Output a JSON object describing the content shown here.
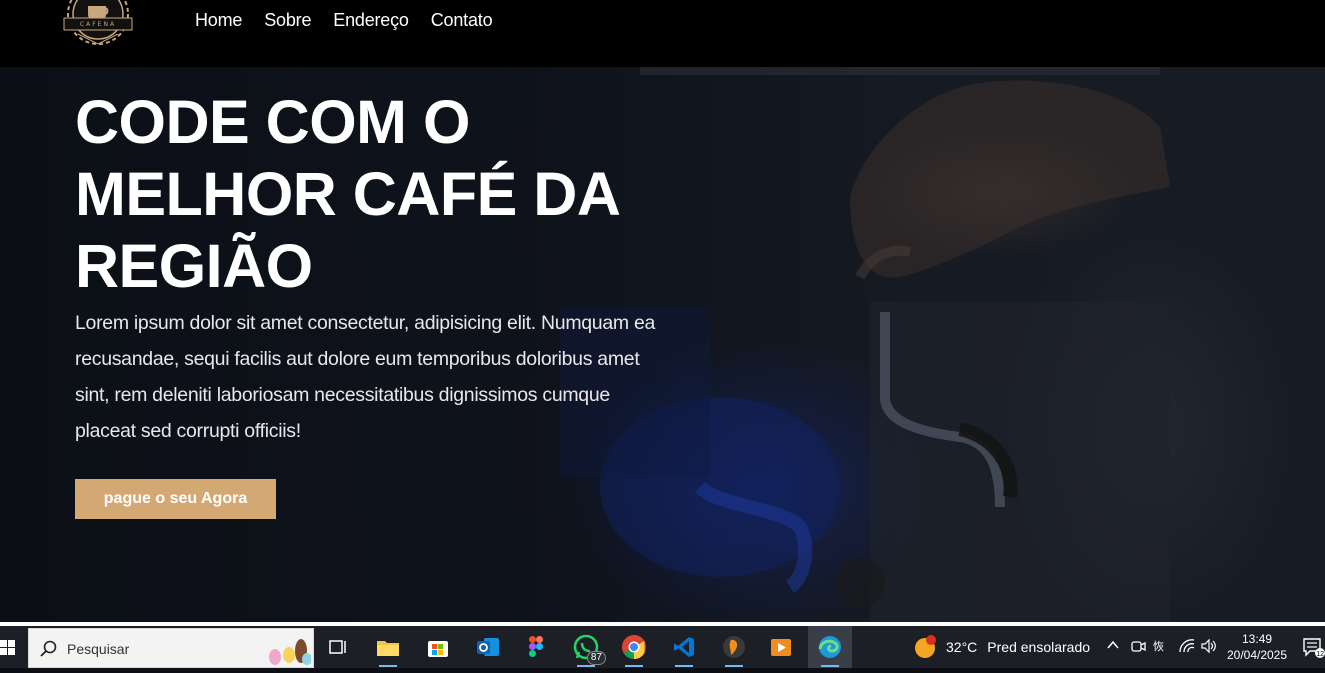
{
  "nav": {
    "logo_text": "CAFENA",
    "links": [
      "Home",
      "Sobre",
      "Endereço",
      "Contato"
    ]
  },
  "hero": {
    "title": "CODE COM O MELHOR CAFÉ DA REGIÃO",
    "text": "Lorem ipsum dolor sit amet consectetur, adipisicing elit. Numquam ea recusandae, sequi facilis aut dolore eum temporibus doloribus amet sint, rem deleniti laboriosam necessitatibus dignissimos cumque placeat sed corrupti officiis!",
    "button_label": "pague o seu Agora"
  },
  "taskbar": {
    "search_placeholder": "Pesquisar",
    "apps": [
      {
        "name": "task-view-icon"
      },
      {
        "name": "file-explorer-icon"
      },
      {
        "name": "microsoft-store-icon"
      },
      {
        "name": "outlook-icon"
      },
      {
        "name": "figma-icon"
      },
      {
        "name": "whatsapp-icon",
        "badge": "87"
      },
      {
        "name": "chrome-icon"
      },
      {
        "name": "vscode-icon"
      },
      {
        "name": "fl-studio-icon"
      },
      {
        "name": "media-player-icon"
      },
      {
        "name": "edge-icon"
      }
    ],
    "weather": {
      "badge": "1",
      "temp": "32°C",
      "desc": "Pred ensolarado"
    },
    "clock": {
      "time": "13:49",
      "date": "20/04/2025"
    },
    "notification_count": "12"
  },
  "colors": {
    "accent": "#d4a873",
    "nav_bg": "#000000",
    "taskbar_bg": "#1c1f26"
  }
}
